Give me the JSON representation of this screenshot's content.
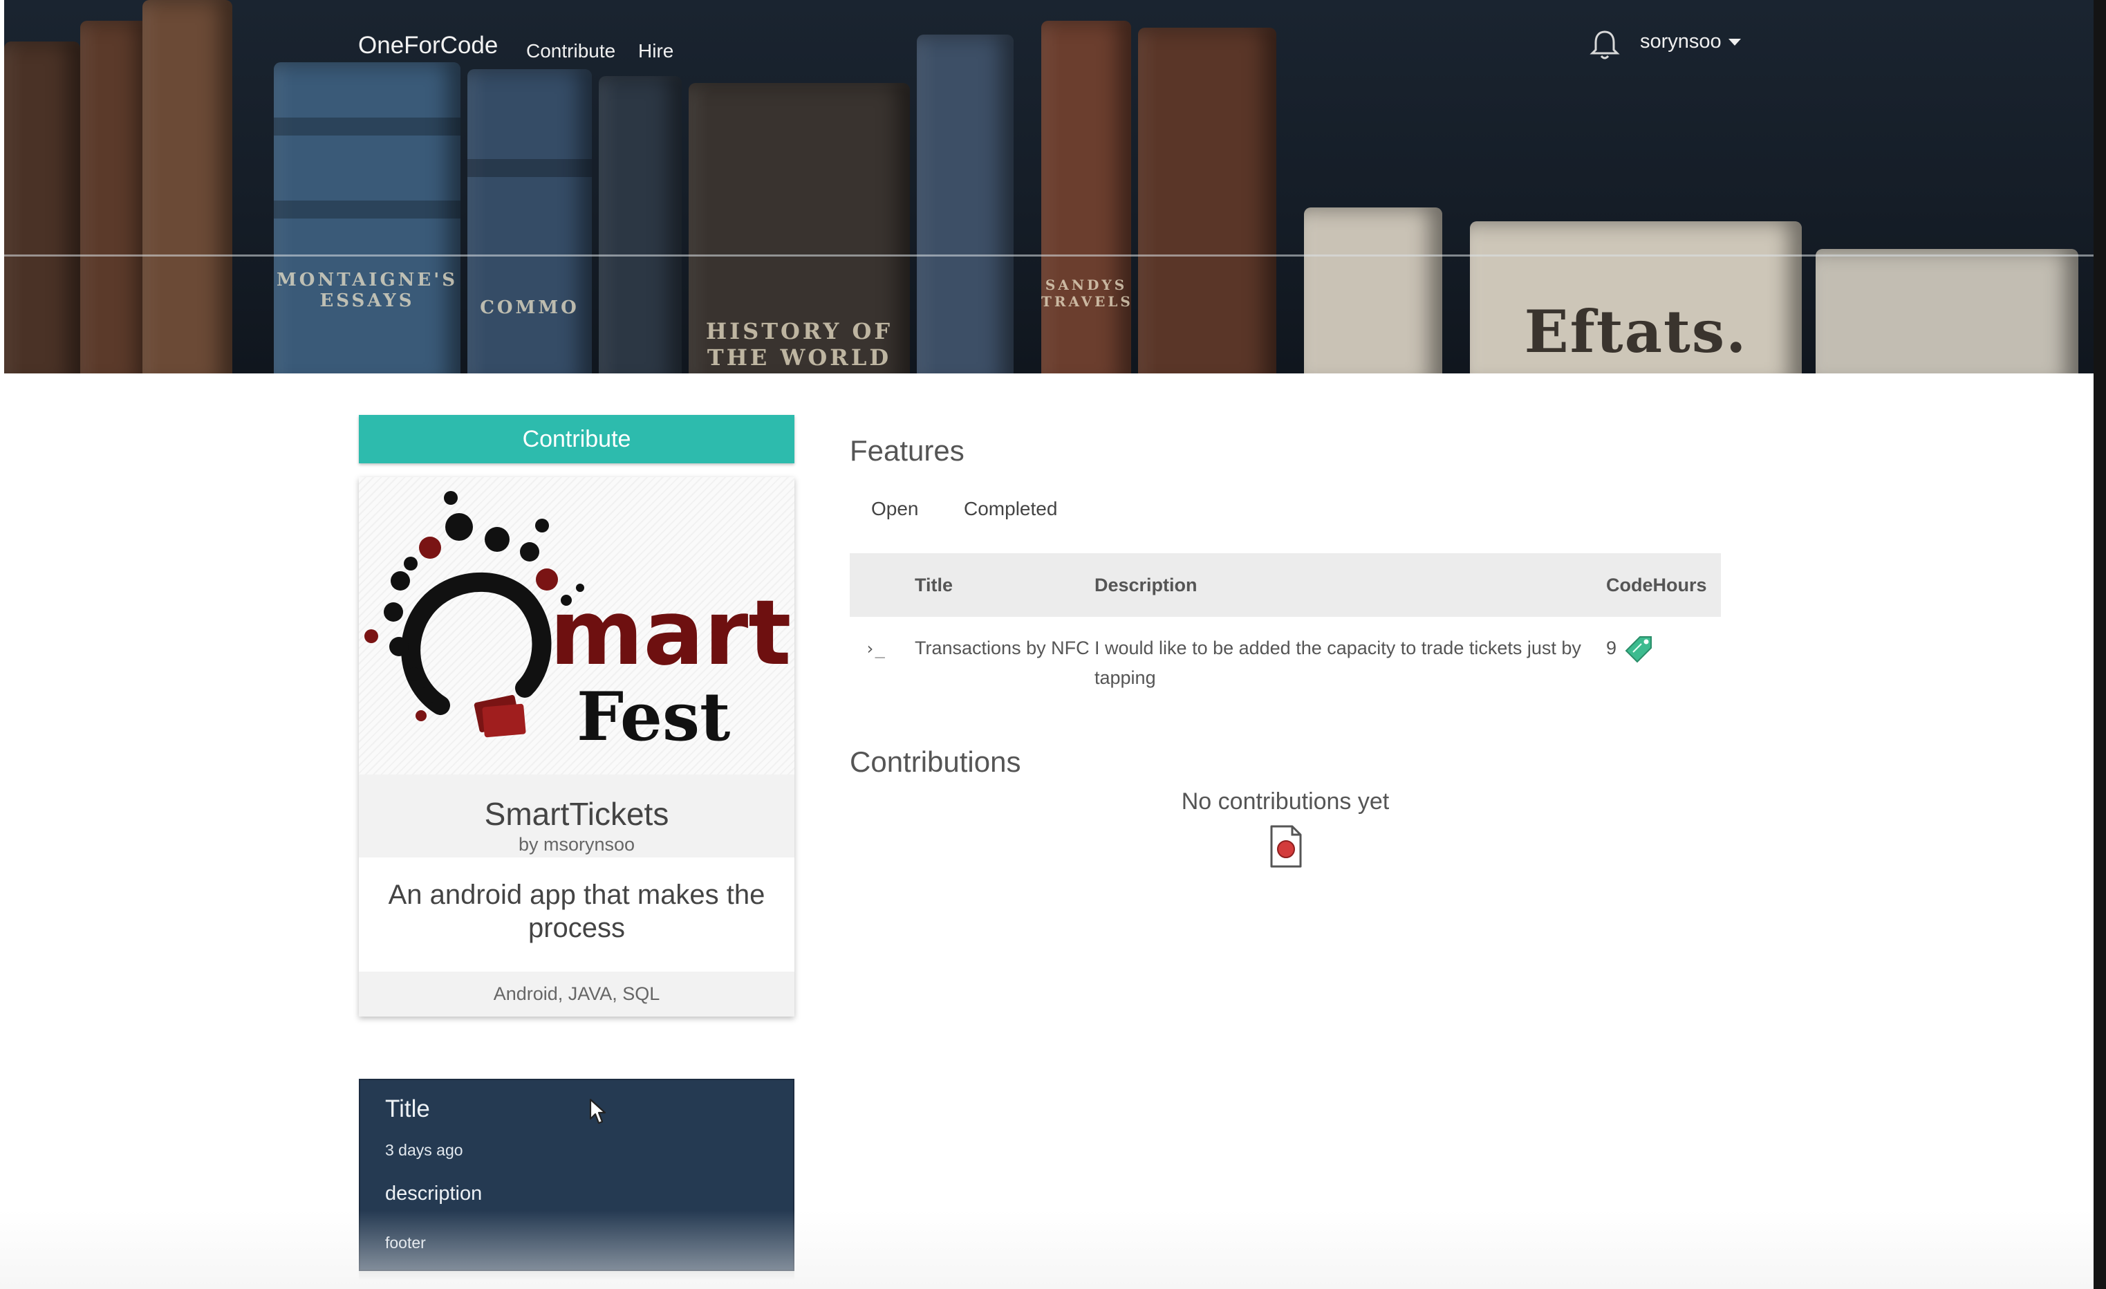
{
  "nav": {
    "brand": "OneForCode",
    "links": [
      {
        "label": "Contribute"
      },
      {
        "label": "Hire"
      }
    ],
    "username": "sorynsoo"
  },
  "hero": {
    "spine_labels": [
      "MONTAIGNE'S ESSAYS",
      "COMMO",
      "HISTORY OF THE WORLD",
      "SANDYS TRAVELS",
      "Eftats."
    ]
  },
  "sidebar": {
    "contribute_label": "Contribute",
    "project": {
      "logo_text_1": "mart",
      "logo_text_2": "Fest",
      "name": "SmartTickets",
      "author": "by msorynsoo",
      "description": "An android app that makes the process",
      "tags": "Android, JAVA, SQL"
    },
    "post_card": {
      "title": "Title",
      "time": "3 days ago",
      "description": "description",
      "footer": "footer"
    }
  },
  "features": {
    "heading": "Features",
    "tabs": [
      {
        "label": "Open"
      },
      {
        "label": "Completed"
      }
    ],
    "columns": {
      "title": "Title",
      "description": "Description",
      "codehours": "CodeHours"
    },
    "rows": [
      {
        "expand_glyph": "›_",
        "title": "Transactions by NFC",
        "description": "I would like to be added the capacity to trade tickets just by tapping",
        "codehours": "9"
      }
    ]
  },
  "contributions": {
    "heading": "Contributions",
    "empty_text": "No contributions yet"
  },
  "colors": {
    "accent": "#2dbbad",
    "post_card": "#253a52",
    "logo_dark_red": "#7a1414"
  }
}
